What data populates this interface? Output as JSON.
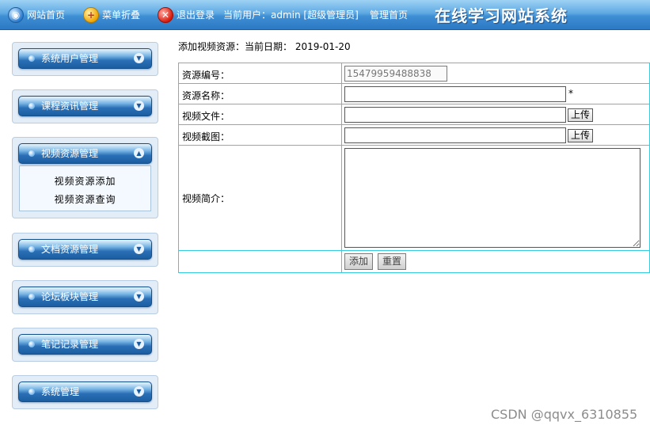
{
  "topbar": {
    "home_label": "网站首页",
    "fold_label": "菜单折叠",
    "logout_label": "退出登录",
    "user_text": "当前用户：admin [超级管理员]",
    "admin_home_label": "管理首页",
    "site_title": "在线学习网站系统"
  },
  "sidebar": {
    "menus": [
      {
        "label": "系统用户管理"
      },
      {
        "label": "课程资讯管理"
      },
      {
        "label": "视频资源管理",
        "expanded": true,
        "items": [
          {
            "label": "视频资源添加"
          },
          {
            "label": "视频资源查询"
          }
        ]
      },
      {
        "label": "文档资源管理"
      },
      {
        "label": "论坛板块管理"
      },
      {
        "label": "笔记记录管理"
      },
      {
        "label": "系统管理"
      }
    ]
  },
  "main": {
    "heading": "添加视频资源：",
    "date_label": "当前日期：",
    "date_value": "2019-01-20",
    "form": {
      "id_label": "资源编号：",
      "id_value": "15479959488838",
      "name_label": "资源名称：",
      "name_value": "",
      "required_mark": "*",
      "file_label": "视频文件：",
      "file_value": "",
      "shot_label": "视频截图：",
      "shot_value": "",
      "upload_label": "上传",
      "intro_label": "视频简介：",
      "intro_value": "",
      "add_label": "添加",
      "reset_label": "重置"
    }
  },
  "watermark": "CSDN @qqvx_6310855",
  "colors": {
    "topbar": "#3f8fd4",
    "table_border": "#33cfe0",
    "menu_head": "#2a6fb6"
  }
}
